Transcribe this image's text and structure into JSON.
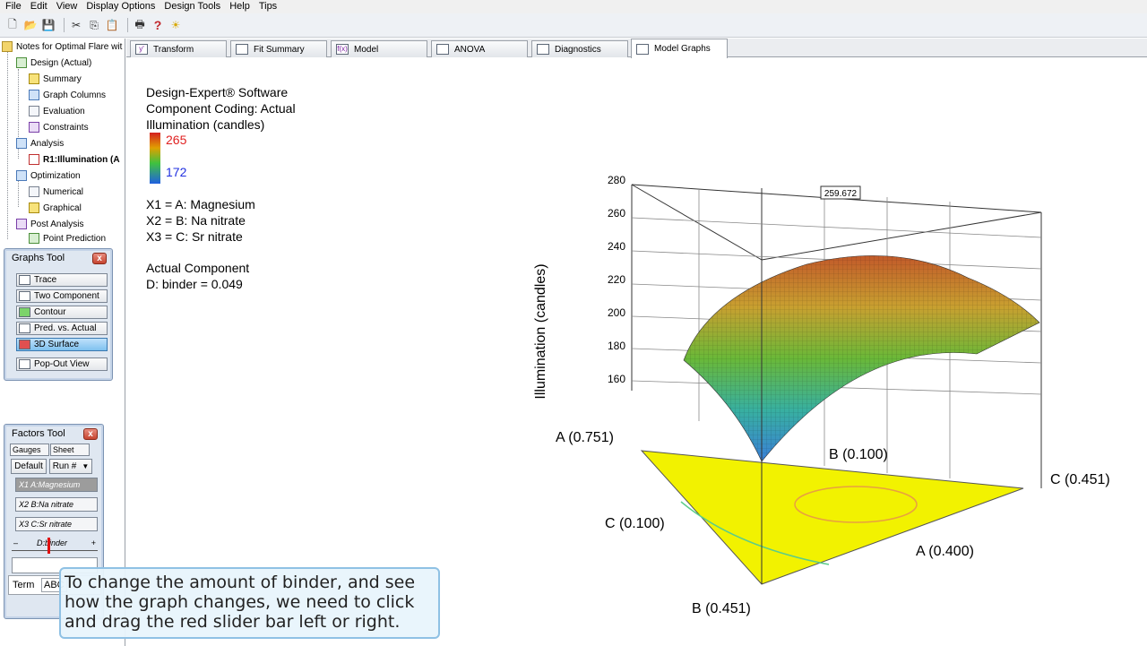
{
  "menu": [
    "File",
    "Edit",
    "View",
    "Display Options",
    "Design Tools",
    "Help",
    "Tips"
  ],
  "tree": {
    "root": "Notes for Optimal Flare wit",
    "design": "Design (Actual)",
    "summary": "Summary",
    "graph_columns": "Graph Columns",
    "evaluation": "Evaluation",
    "constraints": "Constraints",
    "analysis": "Analysis",
    "response": "R1:Illumination (A",
    "optimization": "Optimization",
    "numerical": "Numerical",
    "graphical": "Graphical",
    "post_analysis": "Post Analysis",
    "point_prediction": "Point Prediction"
  },
  "graphs_tool": {
    "title": "Graphs Tool",
    "buttons": [
      "Trace",
      "Two Component",
      "Contour",
      "Pred. vs. Actual",
      "3D Surface"
    ],
    "popout": "Pop-Out View"
  },
  "factors_tool": {
    "title": "Factors Tool",
    "tab_gauges": "Gauges",
    "tab_sheet": "Sheet",
    "default_btn": "Default",
    "run_select": "Run #",
    "factors": [
      "X1 A:Magnesium",
      "X2 B:Na nitrate",
      "X3 C:Sr nitrate"
    ],
    "slider_label": "D:binder",
    "slider_minus": "–",
    "slider_plus": "+",
    "term_tab": "Term",
    "abc_tab": "ABC"
  },
  "tabs": [
    "Transform",
    "Fit Summary",
    "Model",
    "ANOVA",
    "Diagnostics",
    "Model Graphs"
  ],
  "info": {
    "software": "Design-Expert® Software",
    "coding": "Component Coding: Actual",
    "response": "Illumination (candles)",
    "legend_hi": "265",
    "legend_lo": "172",
    "x1": "X1 = A: Magnesium",
    "x2": "X2 = B: Na nitrate",
    "x3": "X3 = C: Sr nitrate",
    "actual_component": "Actual Component",
    "binder": "D: binder = 0.049"
  },
  "chart_data": {
    "type": "3d-surface",
    "zlabel": "Illumination (candles)",
    "z_ticks": [
      "160",
      "180",
      "200",
      "220",
      "240",
      "260",
      "280"
    ],
    "annotation": "259.672",
    "vertex_labels": [
      "A (0.751)",
      "B (0.100)",
      "C (0.451)",
      "C (0.100)",
      "A (0.400)",
      "B (0.451)"
    ]
  },
  "callout": "To change the amount of binder, and see how the graph changes, we need to click and drag the red slider bar left or right."
}
